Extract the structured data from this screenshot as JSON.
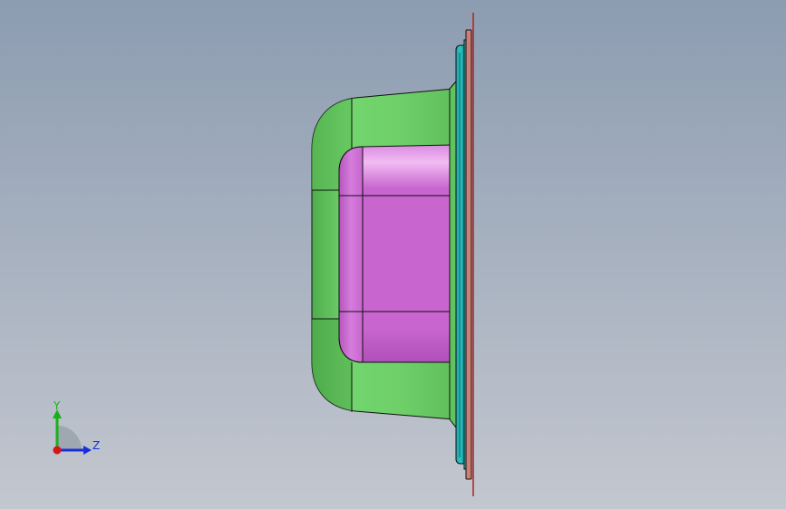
{
  "viewport": {
    "background_top": "#8c9cb1",
    "background_bottom": "#c3c7cf"
  },
  "model": {
    "cavity_color": "#c865cf",
    "cavity_highlight": "#f0b6f1",
    "body_color": "#72d56d",
    "body_dark": "#4fae4c",
    "flange_color": "#1fb3b4",
    "plate_color": "#cc7f76",
    "edge_color": "#101010"
  },
  "triad": {
    "y_label": "Y",
    "z_label": "Z",
    "y_color": "#15b21a",
    "z_color": "#1a2fd8",
    "x_color": "#d81414"
  }
}
